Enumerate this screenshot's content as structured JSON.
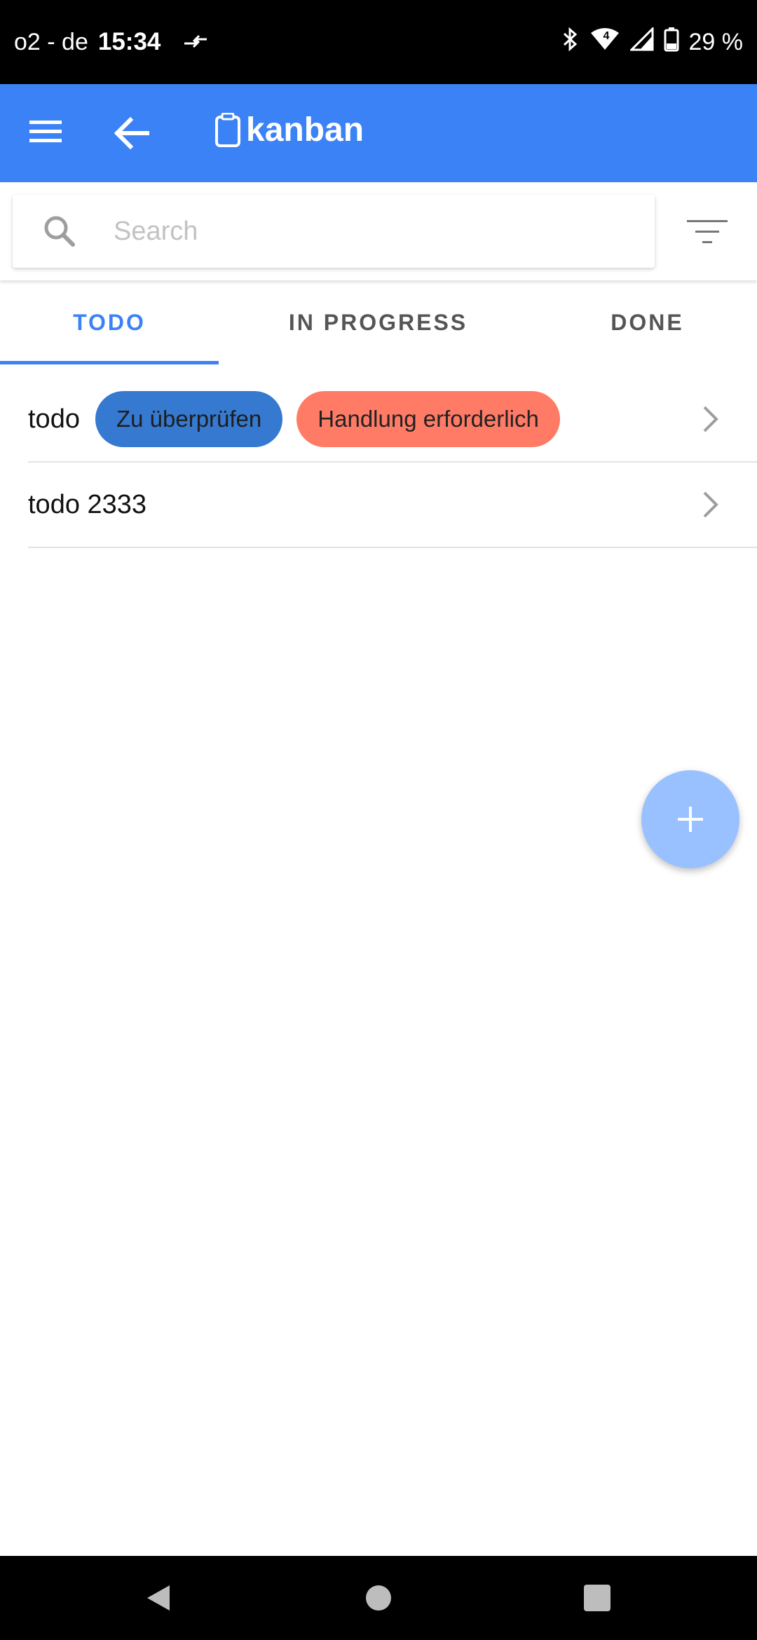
{
  "status_bar": {
    "carrier": "o2 - de",
    "time": "15:34",
    "network_badge": "4",
    "battery": "29 %",
    "icons": [
      "data-arrows-icon",
      "bluetooth-icon",
      "wifi-icon",
      "signal-icon",
      "battery-icon"
    ]
  },
  "app_bar": {
    "title": "kanban",
    "title_icon": "clipboard-icon",
    "menu_icon": "menu-icon",
    "back_icon": "arrow-back-icon"
  },
  "search": {
    "placeholder": "Search",
    "value": "",
    "filter_icon": "filter-icon"
  },
  "tabs": [
    {
      "label": "TODO",
      "active": true
    },
    {
      "label": "IN PROGRESS",
      "active": false
    },
    {
      "label": "DONE",
      "active": false
    }
  ],
  "items": [
    {
      "title": "todo",
      "tags": [
        "Zu überprüfen",
        "Handlung erforderlich"
      ]
    },
    {
      "title": "todo 2333",
      "tags": []
    }
  ],
  "fab_icon": "plus-icon",
  "colors": {
    "accent": "#3b82f6",
    "tag_review": "#3579d0",
    "tag_action": "#ff7b66",
    "fab": "#99c1ff"
  }
}
